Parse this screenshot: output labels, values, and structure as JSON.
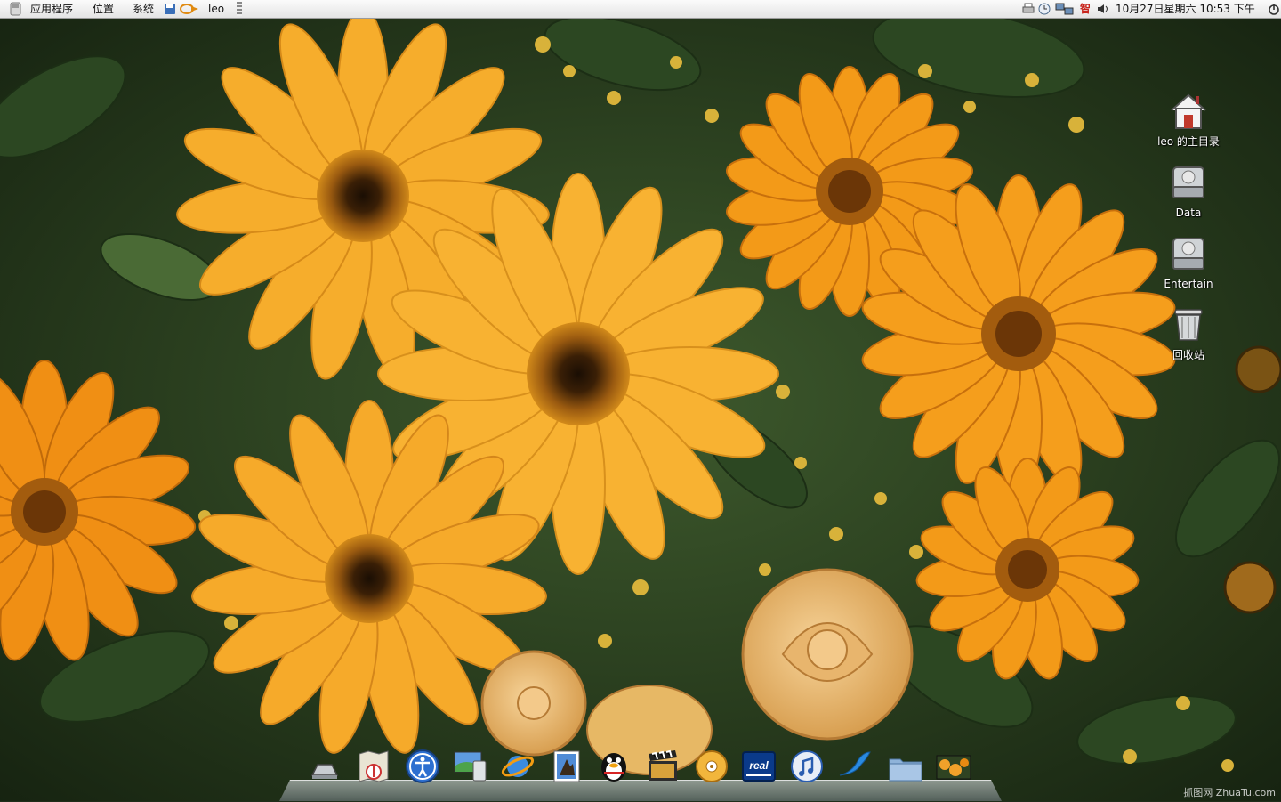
{
  "top_panel": {
    "menus": {
      "applications": "应用程序",
      "places": "位置",
      "system": "系统"
    },
    "user": "leo",
    "clock": "10月27日星期六 10:53 下午"
  },
  "desktop": {
    "icons": [
      {
        "name": "home-folder",
        "label": "leo 的主目录"
      },
      {
        "name": "data-drive",
        "label": "Data"
      },
      {
        "name": "entertain-drive",
        "label": "Entertain"
      },
      {
        "name": "trash",
        "label": "回收站"
      }
    ]
  },
  "dock": {
    "items": [
      "drive-icon",
      "map-icon",
      "accessibility-icon",
      "desktop-preview-icon",
      "browser-icon",
      "photo-icon",
      "qq-penguin-icon",
      "movie-icon",
      "music-disc-icon",
      "realplayer-icon",
      "itunes-icon",
      "bird-app-icon",
      "folder-icon",
      "flowers-thumbnail-icon"
    ],
    "realplayer_label": "real"
  },
  "watermark": "抓图网 ZhuaTu.com",
  "colors": {
    "panel": "#eeeeee",
    "petal": "#f5a623",
    "leaf": "#2f4a27"
  }
}
